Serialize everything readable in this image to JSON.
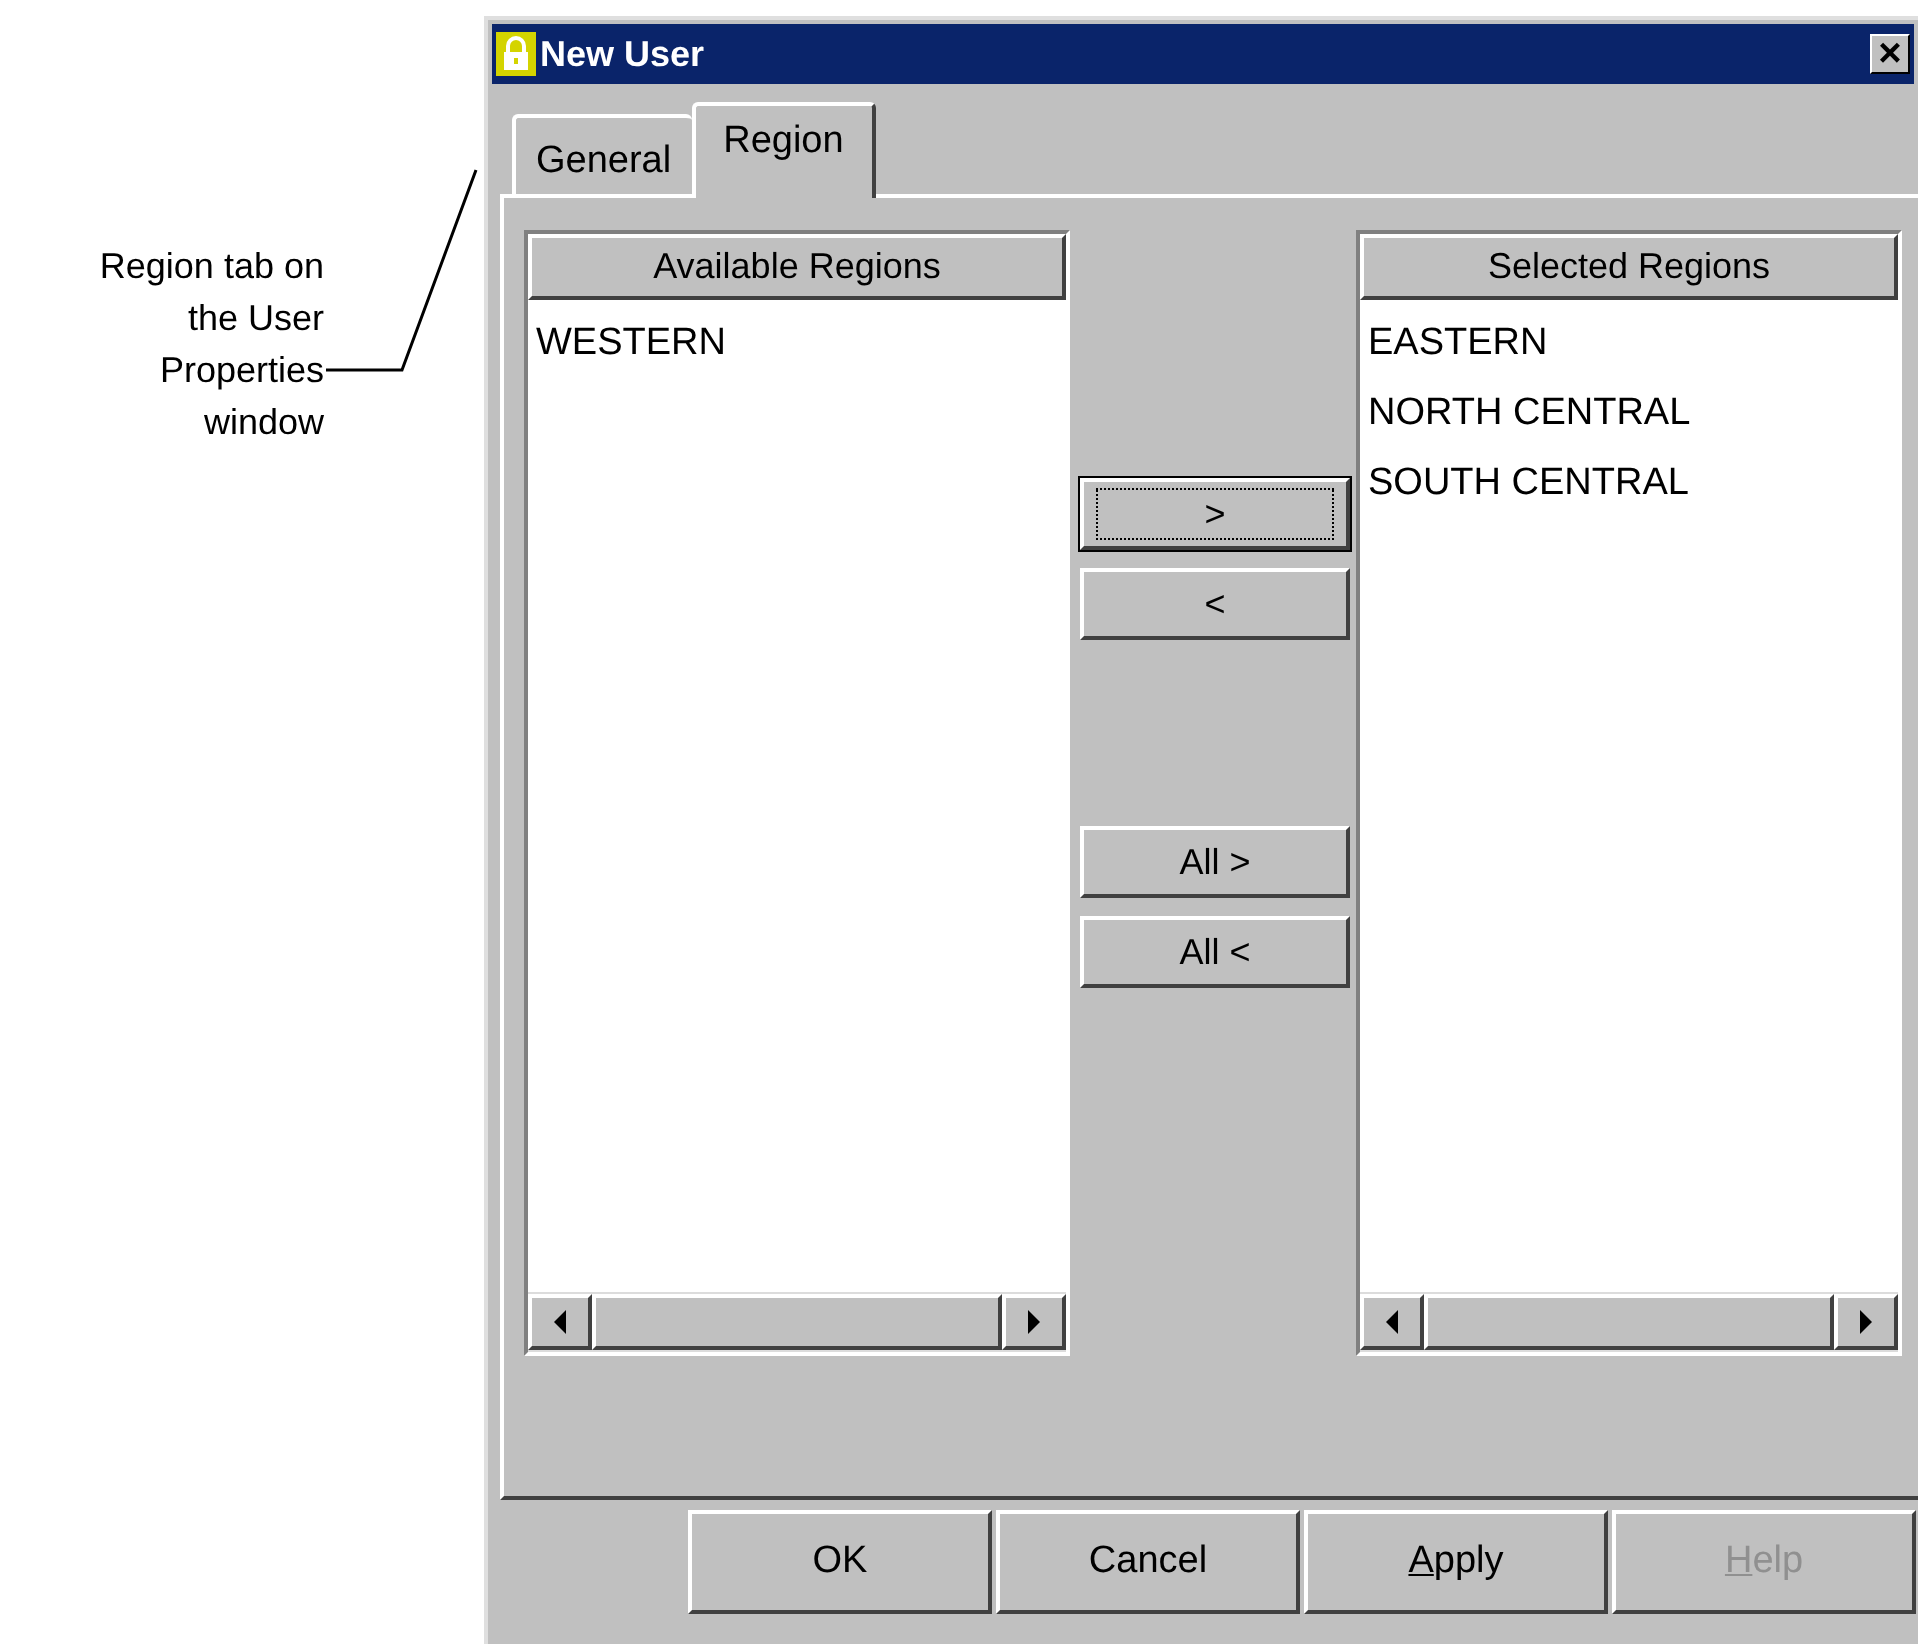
{
  "annotation": {
    "text": "Region tab on the User Properties window"
  },
  "window": {
    "title": "New User",
    "close": "×"
  },
  "tabs": [
    {
      "label": "General",
      "selected": false
    },
    {
      "label": "Region",
      "selected": true
    }
  ],
  "available": {
    "header": "Available Regions",
    "items": [
      "WESTERN"
    ]
  },
  "move_buttons": [
    {
      "label": ">",
      "focused": true
    },
    {
      "label": "<",
      "focused": false
    },
    {
      "label": "All >",
      "focused": false
    },
    {
      "label": "All <",
      "focused": false
    }
  ],
  "selected": {
    "header": "Selected Regions",
    "items": [
      "EASTERN",
      "NORTH CENTRAL",
      "SOUTH CENTRAL"
    ]
  },
  "buttons": [
    {
      "label": "OK",
      "underline_first": false,
      "disabled": false
    },
    {
      "label": "Cancel",
      "underline_first": false,
      "disabled": false
    },
    {
      "label": "Apply",
      "underline_first": true,
      "disabled": false
    },
    {
      "label": "Help",
      "underline_first": true,
      "disabled": true
    }
  ]
}
